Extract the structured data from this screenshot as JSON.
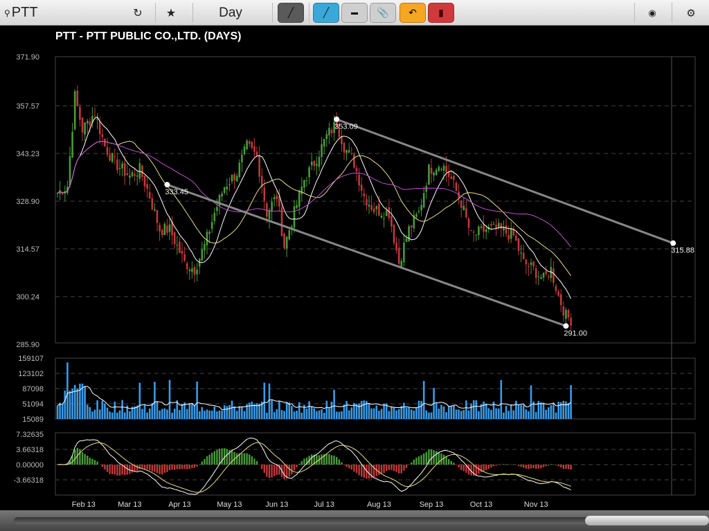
{
  "toolbar": {
    "search": "PTT",
    "period": "Day",
    "icons": [
      "search-icon",
      "refresh-icon",
      "star-icon",
      "draw-pen-icon",
      "line-tool-icon",
      "ruler-icon",
      "paperclip-icon",
      "undo-icon",
      "trash-icon",
      "camera-icon",
      "gear-icon"
    ],
    "colors": {
      "pen": "#555555",
      "line": "#3aa8d8",
      "ruler": "#c8c8c8",
      "clip": "#c8c8c8",
      "undo": "#f5a623",
      "trash": "#d0393b"
    }
  },
  "chart_title": "PTT - PTT PUBLIC CO.,LTD. (DAYS)",
  "chart_data": {
    "type": "candlestick",
    "bars": 207,
    "price_axis": {
      "ticks": [
        "371.90",
        "357.57",
        "343.23",
        "328.90",
        "314.57",
        "300.24",
        "285.90"
      ],
      "ylim": [
        285.9,
        371.9
      ]
    },
    "price_waypoints": [
      [
        0,
        331
      ],
      [
        4,
        333
      ],
      [
        7,
        360
      ],
      [
        10,
        350
      ],
      [
        15,
        355
      ],
      [
        19,
        345
      ],
      [
        23,
        340
      ],
      [
        29,
        336
      ],
      [
        33,
        338
      ],
      [
        37,
        330
      ],
      [
        41,
        320
      ],
      [
        45,
        320
      ],
      [
        51,
        310
      ],
      [
        55,
        308
      ],
      [
        59,
        315
      ],
      [
        63,
        325
      ],
      [
        67,
        333
      ],
      [
        72,
        337
      ],
      [
        76,
        345
      ],
      [
        80,
        342
      ],
      [
        84,
        325
      ],
      [
        88,
        330
      ],
      [
        91,
        315
      ],
      [
        95,
        325
      ],
      [
        99,
        335
      ],
      [
        103,
        340
      ],
      [
        108,
        348
      ],
      [
        112,
        352
      ],
      [
        115,
        345
      ],
      [
        119,
        340
      ],
      [
        123,
        330
      ],
      [
        127,
        326
      ],
      [
        133,
        325
      ],
      [
        137,
        310
      ],
      [
        141,
        320
      ],
      [
        145,
        325
      ],
      [
        149,
        338
      ],
      [
        154,
        340
      ],
      [
        158,
        335
      ],
      [
        162,
        328
      ],
      [
        166,
        318
      ],
      [
        172,
        320
      ],
      [
        177,
        320
      ],
      [
        183,
        318
      ],
      [
        187,
        310
      ],
      [
        191,
        308
      ],
      [
        195,
        305
      ],
      [
        198,
        308
      ],
      [
        201,
        300
      ],
      [
        204,
        294
      ],
      [
        206,
        293
      ]
    ],
    "moving_averages": [
      {
        "period": 10,
        "color": "#ffffff"
      },
      {
        "period": 25,
        "color": "#e8e08a"
      },
      {
        "period": 50,
        "color": "#c050d0"
      }
    ],
    "volume_axis": {
      "ticks": [
        "159107",
        "123102",
        "87098",
        "51094",
        "15089"
      ],
      "ylim": [
        15089,
        159107
      ]
    },
    "macd_axis": {
      "ticks": [
        "7.32635",
        "3.66318",
        "0.00000",
        "-3.66318"
      ],
      "ylim": [
        -7.5,
        7.32635
      ]
    },
    "x_labels": [
      {
        "bar": 10.5,
        "label": "Feb 13"
      },
      {
        "bar": 29,
        "label": "Mar 13"
      },
      {
        "bar": 49,
        "label": "Apr 13"
      },
      {
        "bar": 69,
        "label": "May 13"
      },
      {
        "bar": 88,
        "label": "Jun 13"
      },
      {
        "bar": 107,
        "label": "Jul 13"
      },
      {
        "bar": 129,
        "label": "Aug 13"
      },
      {
        "bar": 150,
        "label": "Sep 13"
      },
      {
        "bar": 170,
        "label": "Oct 13"
      },
      {
        "bar": 192,
        "label": "Nov 13"
      }
    ],
    "trendlines": [
      {
        "from": {
          "bar": 44,
          "price": 333.45,
          "label": "333.45"
        },
        "to": {
          "bar": 204,
          "price": 291.0,
          "label": "291.00"
        }
      },
      {
        "from": {
          "bar": 112,
          "price": 353.09,
          "label": "353.09"
        },
        "to": {
          "bar": 247,
          "price": 315.88,
          "label": "315.88"
        }
      }
    ],
    "colors": {
      "up": "#4a9a3a",
      "down": "#c0393b",
      "volume": "#3a9be8",
      "grid": "#444444"
    }
  }
}
